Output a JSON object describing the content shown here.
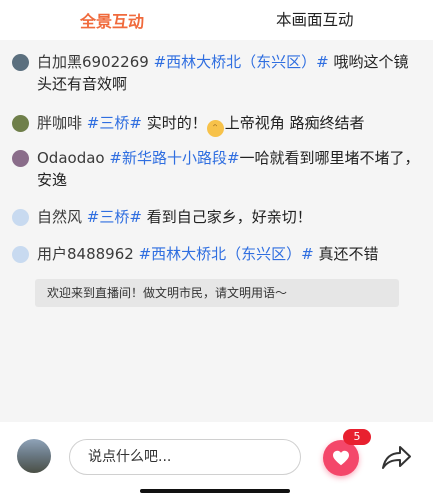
{
  "tabs": {
    "active": "全景互动",
    "inactive": "本画面互动"
  },
  "messages": [
    {
      "user": "白加黑6902269",
      "tag": "#西林大桥北（东兴区）#",
      "text": " 哦哟这个镜头还有音效啊",
      "avatar_color": "#5b6f7e"
    },
    {
      "user": "胖咖啡",
      "tag": "#三桥#",
      "text_before": " 实时的！",
      "emoji": "crazy-face-emoji",
      "text_after": "上帝视角 路痴终结者",
      "avatar_color": "#6f7f4a"
    },
    {
      "user": "Odaodao",
      "tag": "#新华路十小路段#",
      "text": "一哈就看到哪里堵不堵了，安逸",
      "avatar_color": "#8a6d8a"
    },
    {
      "user": "自然风",
      "tag": "#三桥#",
      "text": " 看到自己家乡，好亲切！",
      "avatar_color": "#c8daf0"
    },
    {
      "user": "用户8488962",
      "tag": "#西林大桥北（东兴区）#",
      "text": " 真还不错",
      "avatar_color": "#c8daf0"
    }
  ],
  "notice": "欢迎来到直播间！做文明市民，请文明用语～",
  "composer": {
    "placeholder": "说点什么吧..."
  },
  "like": {
    "count": "5"
  },
  "colors": {
    "accent": "#f06a3c",
    "tag": "#2f6ee0",
    "like": "#f4476a",
    "badge": "#e8202f"
  },
  "icons": [
    "heart-icon",
    "share-icon",
    "user-avatar-icon"
  ]
}
